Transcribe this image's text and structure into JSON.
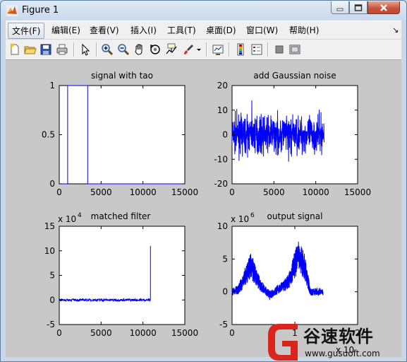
{
  "window": {
    "title": "Figure 1"
  },
  "menubar": {
    "items": [
      "文件(F)",
      "编辑(E)",
      "查看(V)",
      "插入(I)",
      "工具(T)",
      "桌面(D)",
      "窗口(W)",
      "帮助(H)"
    ],
    "overflow_glyph": "↘"
  },
  "toolbar": {
    "icons": [
      "new-figure-icon",
      "open-file-icon",
      "save-icon",
      "print-icon",
      "edit-plot-arrow-icon",
      "zoom-in-icon",
      "zoom-out-icon",
      "pan-hand-icon",
      "rotate-3d-icon",
      "data-cursor-icon",
      "brush-icon",
      "brush-dropdown-icon",
      "link-plot-icon",
      "insert-colorbar-icon",
      "insert-legend-icon",
      "hide-plot-tools-icon",
      "show-plot-tools-icon"
    ]
  },
  "colors": {
    "line": "#0000ff",
    "figure_bg": "#c8c8c8",
    "axes_bg": "#ffffff"
  },
  "chart_data": [
    {
      "type": "line",
      "title": "signal with tao",
      "xlim": [
        0,
        15000
      ],
      "ylim": [
        0,
        1
      ],
      "xticks": [
        "0",
        "5000",
        "10000",
        "15000"
      ],
      "yticks": [
        "0",
        "0.5",
        "1"
      ],
      "x": [
        0,
        1000,
        1000,
        3400,
        3400,
        15000
      ],
      "y": [
        0,
        0,
        1,
        1,
        0,
        0
      ]
    },
    {
      "type": "line",
      "title": "add Gaussian noise",
      "xlim": [
        0,
        15000
      ],
      "ylim": [
        -20,
        20
      ],
      "xticks": [
        "0",
        "5000",
        "10000",
        "15000"
      ],
      "yticks": [
        "-20",
        "-10",
        "0",
        "10",
        "20"
      ],
      "noise_x_range": [
        0,
        11000
      ],
      "noise_band": [
        -8,
        8
      ],
      "noise_peaks": [
        -11,
        14
      ]
    },
    {
      "type": "line",
      "title": "matched filter",
      "exponent": "4",
      "xlim": [
        0,
        15000
      ],
      "ylim": [
        -5,
        15
      ],
      "xticks": [
        "0",
        "5000",
        "10000",
        "15000"
      ],
      "yticks": [
        "-5",
        "0",
        "5",
        "10",
        "15"
      ],
      "baseline": 0,
      "x_end": 10900,
      "spike_value": 11
    },
    {
      "type": "line",
      "title": "output signal",
      "exponent": "6",
      "xlim": [
        0,
        2
      ],
      "ylim": [
        -5,
        10
      ],
      "xticks": [
        "0",
        "1",
        "2"
      ],
      "yticks": [
        "-5",
        "0",
        "5",
        "10"
      ],
      "x_exponent_label": "x 10",
      "envelope": [
        [
          0,
          0
        ],
        [
          0.1,
          0.3
        ],
        [
          0.3,
          4
        ],
        [
          0.45,
          1
        ],
        [
          0.6,
          -0.5
        ],
        [
          0.9,
          1.5
        ],
        [
          1.05,
          5.5
        ],
        [
          1.15,
          4
        ],
        [
          1.25,
          0
        ],
        [
          1.45,
          0
        ]
      ]
    }
  ],
  "watermark": {
    "brand": "谷速软件",
    "url": "www.gusuoft.com"
  }
}
